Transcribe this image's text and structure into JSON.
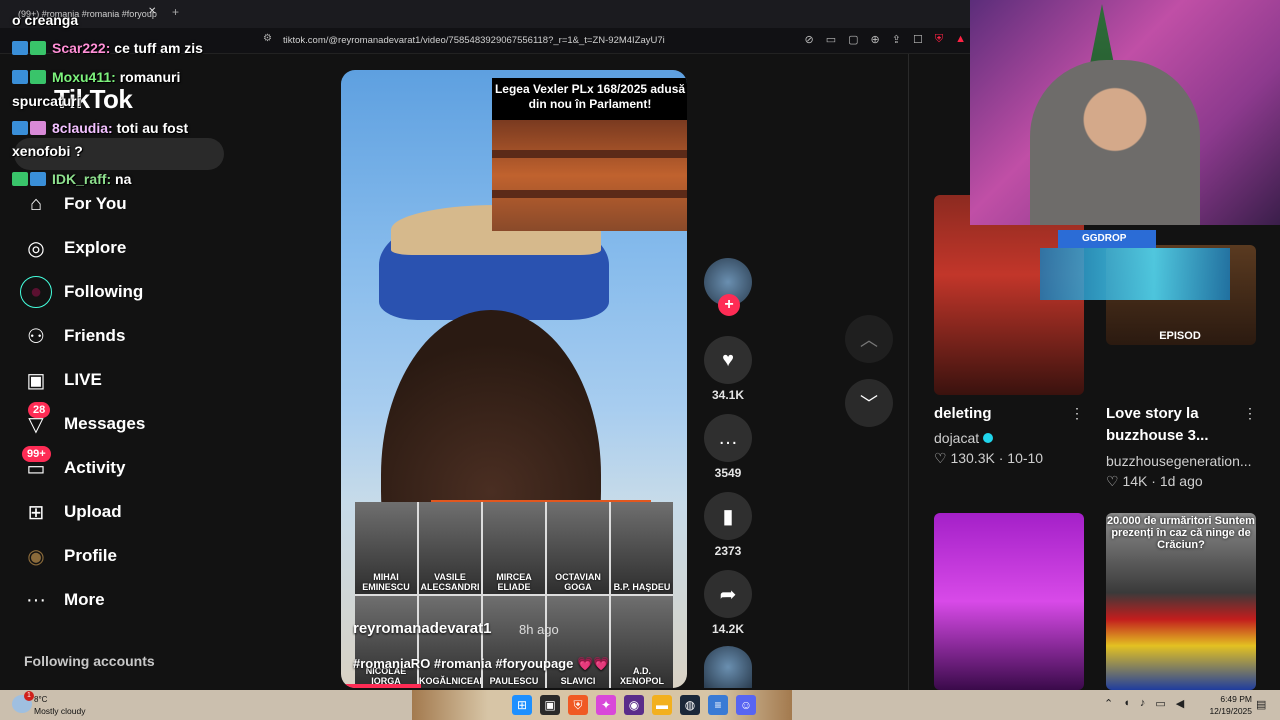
{
  "browser": {
    "tab_title": "(99+) #romania #romania #foryoup",
    "tab_close": "✕",
    "tab_new": "+",
    "url": "tiktok.com/@reyromanadevarat1/video/7585483929067556118?_r=1&_t=ZN-92M4IZayU7i"
  },
  "tiktok": {
    "logo": "TikTok",
    "nav": [
      {
        "id": "for-you",
        "label": "For You",
        "icon": "⌂",
        "badge": ""
      },
      {
        "id": "explore",
        "label": "Explore",
        "icon": "◎",
        "badge": ""
      },
      {
        "id": "following",
        "label": "Following",
        "icon": "●",
        "badge": ""
      },
      {
        "id": "friends",
        "label": "Friends",
        "icon": "⚇",
        "badge": ""
      },
      {
        "id": "live",
        "label": "LIVE",
        "icon": "▣",
        "badge": ""
      },
      {
        "id": "messages",
        "label": "Messages",
        "icon": "▽",
        "badge": "28"
      },
      {
        "id": "activity",
        "label": "Activity",
        "icon": "▭",
        "badge": "99+"
      },
      {
        "id": "upload",
        "label": "Upload",
        "icon": "⊞",
        "badge": ""
      },
      {
        "id": "profile",
        "label": "Profile",
        "icon": "◉",
        "badge": ""
      },
      {
        "id": "more",
        "label": "More",
        "icon": "···",
        "badge": ""
      }
    ],
    "following_accounts": "Following accounts"
  },
  "video": {
    "inset_title": "Legea Vexler PLx 168/2025 adusă din nou în Parlament!",
    "portraits": [
      "MIHAI EMINESCU",
      "VASILE ALECSANDRI",
      "MIRCEA ELIADE",
      "OCTAVIAN GOGA",
      "B.P. HAŞDEU",
      "NICOLAE IORGA",
      "KOGĂLNICEANU",
      "PAULESCU",
      "SLAVICI",
      "A.D. XENOPOL"
    ],
    "username": "reyromanadevarat1",
    "time": "8h ago",
    "hashtags": "#romaniaRO #romania #foryoupage 💗💗",
    "likes": "34.1K",
    "comments": "3549",
    "saves": "2373",
    "shares": "14.2K"
  },
  "recommended": [
    {
      "title": "deleting",
      "author": "dojacat",
      "likes": "130.3K",
      "date": "10-10"
    },
    {
      "title": "Love story la buzzhouse 3...",
      "author": "buzzhousegeneration...",
      "likes": "14K",
      "date": "1d ago"
    }
  ],
  "overlay": {
    "ggdrop": "GGDROP",
    "episod": "EPISOD",
    "thumb4_caption": "20.000 de urmăritori Suntem prezenți în caz că ninge de Crăciun?"
  },
  "chat": [
    {
      "user": "",
      "text": "o creanga"
    },
    {
      "user": "Scar222:",
      "text": " ce tuff am zis"
    },
    {
      "user": "Moxu411:",
      "text": " romanuri"
    },
    {
      "user": "",
      "text": "spurcaturi"
    },
    {
      "user": "8claudia:",
      "text": " toti au fost"
    },
    {
      "user": "",
      "text": "xenofobi ?"
    },
    {
      "user": "IDK_raff:",
      "text": " na"
    }
  ],
  "colors": {
    "moxu": "#7df27d",
    "scar": "#ff8fd6",
    "claudia": "#f2c0ff",
    "idk": "#8ee08e"
  },
  "taskbar": {
    "temp": "8°C",
    "weather": "Mostly cloudy",
    "weather_badge": "1",
    "time": "6:49 PM",
    "date": "12/19/2025"
  }
}
